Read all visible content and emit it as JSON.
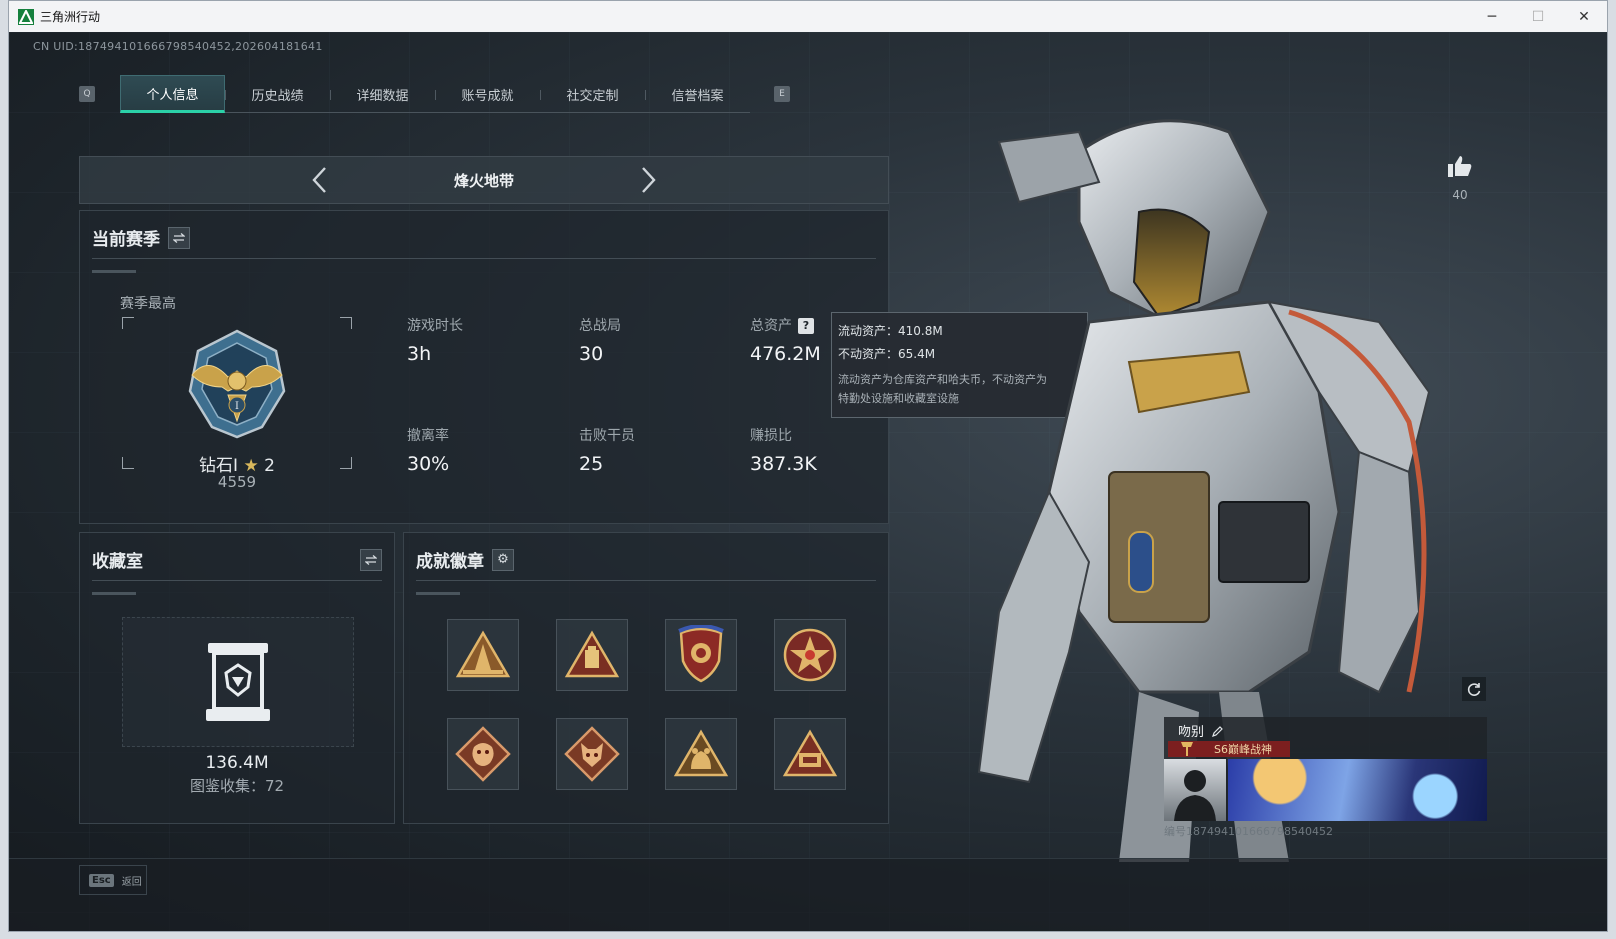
{
  "window": {
    "title": "三角洲行动",
    "controls": [
      "─",
      "☐",
      "✕"
    ]
  },
  "uid": "CN UID:187494101666798540452,202604181641",
  "tabs": {
    "left_key": "Q",
    "right_key": "E",
    "items": [
      "个人信息",
      "历史战绩",
      "详细数据",
      "账号成就",
      "社交定制",
      "信誉档案"
    ],
    "active_index": 0
  },
  "mode": {
    "title": "烽火地带"
  },
  "season": {
    "title": "当前赛季",
    "best_label": "赛季最高",
    "rank_prefix": "钻石Ⅰ",
    "rank_stars": "2",
    "rank_score": "4559",
    "stats": {
      "play_time": {
        "label": "游戏时长",
        "value": "3h"
      },
      "total_matches": {
        "label": "总战局",
        "value": "30"
      },
      "total_assets": {
        "label": "总资产",
        "value": "476.2M"
      },
      "extract_rate": {
        "label": "撤离率",
        "value": "30%"
      },
      "defeated": {
        "label": "击败干员",
        "value": "25"
      },
      "profit_ratio": {
        "label": "赚损比",
        "value": "387.3K"
      }
    },
    "help_glyph": "?"
  },
  "tooltip": {
    "liquid": "流动资产：410.8M",
    "fixed": "不动资产：65.4M",
    "desc_line1": "流动资产为仓库资产和哈夫币，不动资产为",
    "desc_line2": "特勤处设施和收藏室设施"
  },
  "collection": {
    "title": "收藏室",
    "value": "136.4M",
    "sub": "图鉴收集：72"
  },
  "badges": {
    "title": "成就徽章",
    "items": [
      "badge-triangle-tower",
      "badge-triangle-bag",
      "badge-shield-crest",
      "badge-star-emblem",
      "badge-dragon",
      "badge-wolf",
      "badge-bear",
      "badge-triangle-58"
    ]
  },
  "like": {
    "count": "40"
  },
  "card": {
    "name": "吻别",
    "tag": "S6巅峰战神",
    "uid": "编号187494101666798540452"
  },
  "footer": {
    "esc_key": "Esc",
    "esc_label": "返回"
  },
  "colors": {
    "accent": "#2bd1a8",
    "gold": "#c9a24a",
    "tag_red": "#7c1f1f"
  }
}
